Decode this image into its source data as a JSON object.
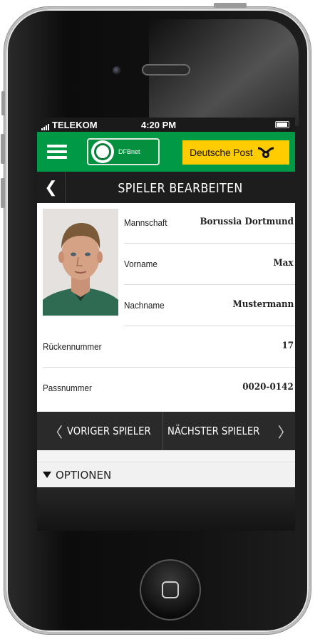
{
  "status_bar": {
    "carrier": "TELEKOM",
    "time": "4:20 PM"
  },
  "header": {
    "menu_icon": "hamburger-icon",
    "logo_text": "DFBnet",
    "sponsor": "Deutsche Post",
    "brand_color": "#009a46",
    "sponsor_color": "#ffcc00"
  },
  "title_bar": {
    "back_icon": "chevron-left-icon",
    "title": "SPIELER BEARBEITEN"
  },
  "player": {
    "fields": [
      {
        "label": "Mannschaft",
        "value": "Borussia Dortmund"
      },
      {
        "label": "Vorname",
        "value": "Max"
      },
      {
        "label": "Nachname",
        "value": "Mustermann"
      },
      {
        "label": "Rückennummer",
        "value": "17"
      },
      {
        "label": "Passnummer",
        "value": "0020-0142"
      }
    ]
  },
  "navigation": {
    "prev_label": "VORIGER SPIELER",
    "next_label": "NÄCHSTER SPIELER"
  },
  "options": {
    "label": "OPTIONEN"
  }
}
